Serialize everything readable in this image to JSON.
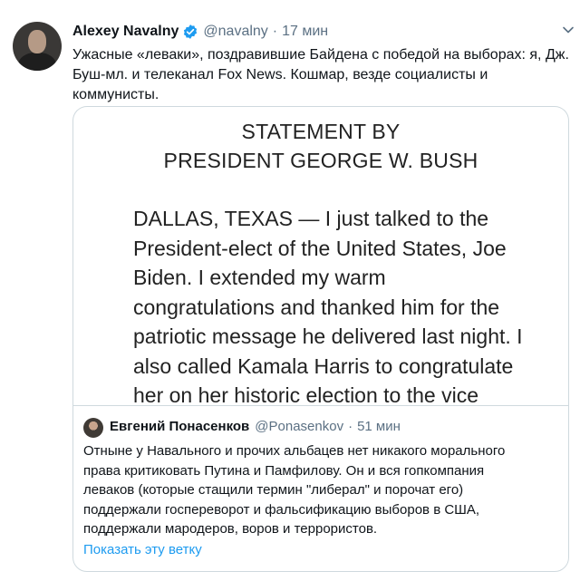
{
  "tweet": {
    "author_name": "Alexey Navalny",
    "handle": "@navalny",
    "separator": "·",
    "time": "17 мин",
    "text": "Ужасные «леваки», поздравившие Байдена с победой на выборах: я, Дж. Буш-мл. и телеканал Fox News. Кошмар, везде социалисты и коммунисты.",
    "verified_color": "#1d9bf0",
    "image": {
      "title_line1": "STATEMENT BY",
      "title_line2": "PRESIDENT GEORGE W. BUSH",
      "body_lines": [
        "DALLAS, TEXAS — I just talked to the",
        "President-elect of the United States, Joe",
        "Biden. I extended my warm",
        "congratulations and thanked him for the",
        "patriotic message he delivered last night. I",
        "also called Kamala Harris to congratulate",
        "her on her historic election to the vice"
      ]
    }
  },
  "quoted": {
    "author_name": "Евгений Понасенков",
    "handle": "@Ponasenkov",
    "separator": "·",
    "time": "51 мин",
    "text_lines": [
      "Отныне у Навального и прочих альбацев нет никакого морального",
      "права критиковать Путина и Памфилову. Он и вся гопкомпания",
      "леваков (которые стащили термин \"либерал\" и порочат его)",
      "поддержали госпереворот и фальсификацию выборов в США,",
      "поддержали мародеров, воров и террористов."
    ],
    "show_thread_label": "Показать эту ветку",
    "link_color": "#1d9bf0"
  }
}
